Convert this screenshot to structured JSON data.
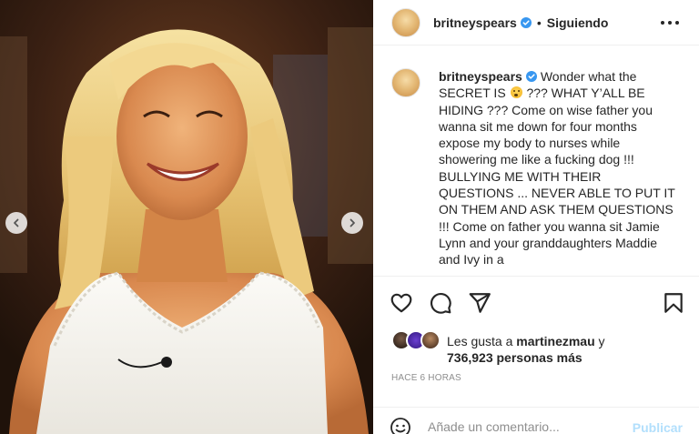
{
  "post": {
    "username": "britneyspears",
    "follow_separator": "•",
    "follow_label": "Siguiendo",
    "caption_part1": "Wonder what the SECRET IS",
    "caption_emoji": "surprised-face-emoji",
    "caption_part2": "??? WHAT Y’ALL BE HIDING ??? Come on wise father you wanna sit me down for four months expose my body to nurses while showering me like a fucking dog !!! BULLYING ME WITH THEIR QUESTIONS ... NEVER ABLE TO PUT IT ON THEM AND ASK THEM QUESTIONS !!! Come on father you wanna sit Jamie Lynn and your granddaughters Maddie and Ivy in a",
    "likes_prefix": "Les gusta a",
    "likes_user": "martinezmau",
    "likes_conjunction": "y",
    "likes_count": "736,923 personas más",
    "timestamp": "HACE 6 HORAS"
  },
  "comment": {
    "placeholder": "Añade un comentario...",
    "publish_label": "Publicar"
  },
  "icons": {
    "verified": "verified-badge-icon",
    "more": "more-options-icon",
    "like": "heart-icon",
    "comment": "comment-icon",
    "share": "paper-plane-icon",
    "save": "bookmark-icon",
    "emoji": "smiley-icon",
    "prev": "chevron-left-icon",
    "next": "chevron-right-icon"
  },
  "colors": {
    "text": "#262626",
    "muted": "#8e8e8e",
    "verified": "#3897f0",
    "publish_disabled": "#b2dffc",
    "divider": "#efefef"
  }
}
